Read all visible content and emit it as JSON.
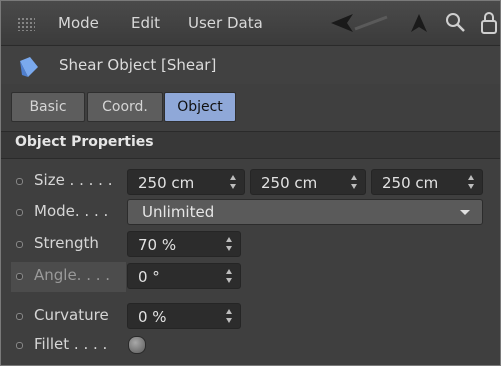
{
  "menu": {
    "items": [
      "Mode",
      "Edit",
      "User Data"
    ]
  },
  "object": {
    "title": "Shear Object [Shear]"
  },
  "tabs": [
    {
      "label": "Basic",
      "active": false
    },
    {
      "label": "Coord.",
      "active": false
    },
    {
      "label": "Object",
      "active": true
    }
  ],
  "section": {
    "title": "Object Properties"
  },
  "params": {
    "size": {
      "label": "Size . . . . .",
      "x": "250 cm",
      "y": "250 cm",
      "z": "250 cm"
    },
    "mode": {
      "label": "Mode. . . .",
      "value": "Unlimited"
    },
    "strength": {
      "label": "Strength",
      "value": "70 %"
    },
    "angle": {
      "label": "Angle. . . .",
      "value": "0 °"
    },
    "curvature": {
      "label": "Curvature",
      "value": "0 %"
    },
    "fillet": {
      "label": "Fillet . . . .",
      "checked": false
    }
  },
  "colors": {
    "panel": "#3f3f3f",
    "active_tab": "#8fa8d8",
    "object_icon": "#8ab4f0"
  },
  "icons": [
    "grip-icon",
    "back-arrow-icon",
    "up-arrow-icon",
    "search-icon",
    "lock-icon",
    "shear-object-icon"
  ]
}
